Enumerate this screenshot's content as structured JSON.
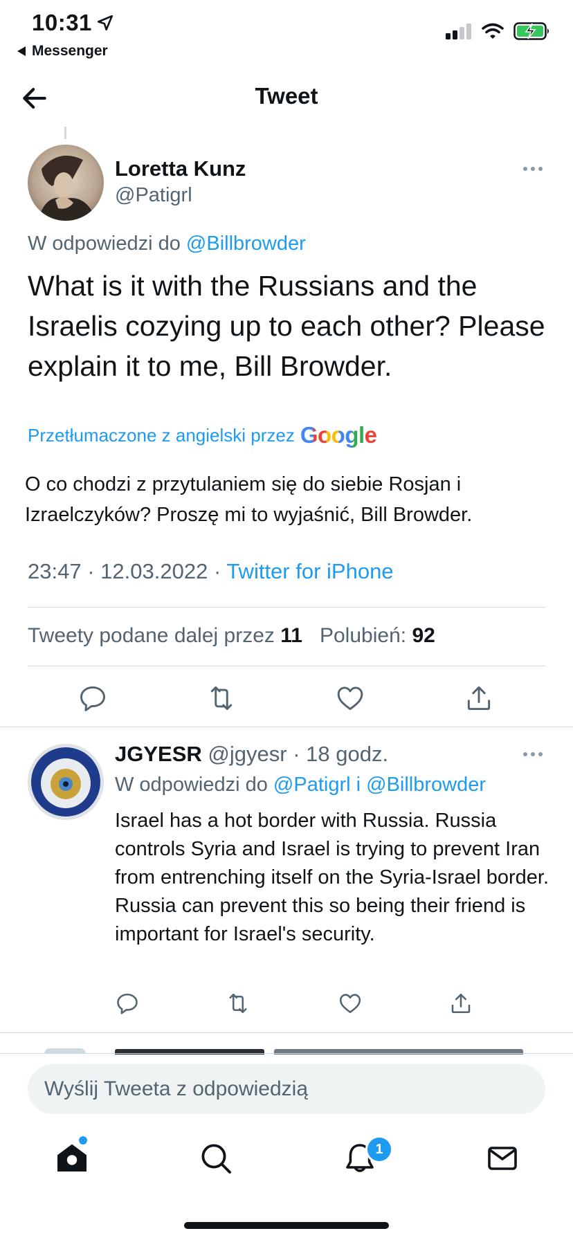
{
  "status_bar": {
    "time": "10:31",
    "back_app": "Messenger",
    "icons": [
      "location-arrow-icon",
      "signal-icon",
      "wifi-icon",
      "battery-charging-icon"
    ]
  },
  "header": {
    "title": "Tweet"
  },
  "main_tweet": {
    "author_name": "Loretta Kunz",
    "author_handle": "@Patigrl",
    "reply_prefix": "W odpowiedzi do",
    "reply_to": "@Billbrowder",
    "text": "What is it with the Russians and the Israelis cozying up to each other? Please explain it to me, Bill Browder.",
    "translated_label": "Przetłumaczone z angielski przez",
    "translator": "Google",
    "translation": "O co chodzi z przytulaniem się do siebie Rosjan i Izraelczyków? Proszę mi to wyjaśnić, Bill Browder.",
    "time": "23:47",
    "date": "12.03.2022",
    "separator": "·",
    "source": "Twitter for iPhone",
    "retweets_label": "Tweety podane dalej przez",
    "retweets_count": "11",
    "likes_label": "Polubień:",
    "likes_count": "92"
  },
  "reply_tweet": {
    "author_name": "JGYESR",
    "author_handle": "@jgyesr",
    "time": "· 18 godz.",
    "reply_prefix": "W odpowiedzi do",
    "reply_to_1": "@Patigrl",
    "reply_conj": "i",
    "reply_to_2": "@Billbrowder",
    "text": "Israel has a hot border with Russia. Russia controls Syria and Israel is trying to prevent Iran from entrenching itself on the Syria-Israel border.  Russia can prevent this so being their friend is important for Israel's security."
  },
  "composer": {
    "placeholder": "Wyślij Tweeta z odpowiedzią"
  },
  "tab_bar": {
    "items": [
      "home-icon",
      "search-icon",
      "notifications-icon",
      "messages-icon"
    ],
    "notifications_badge": "1"
  },
  "colors": {
    "accent": "#1d9bf0",
    "text": "#0f1419",
    "secondary": "#536471",
    "divider": "#cfd9de",
    "battery": "#34c759"
  }
}
